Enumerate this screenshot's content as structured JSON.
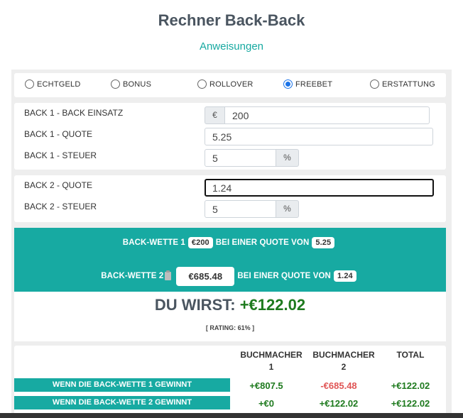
{
  "header": {
    "title": "Rechner Back-Back",
    "instructions_link": "Anweisungen"
  },
  "mode_options": [
    {
      "label": "ECHTGELD",
      "selected": false
    },
    {
      "label": "BONUS",
      "selected": false
    },
    {
      "label": "ROLLOVER",
      "selected": false
    },
    {
      "label": "FREEBET",
      "selected": true
    },
    {
      "label": "ERSTATTUNG",
      "selected": false
    }
  ],
  "back1": {
    "stake_label": "BACK 1 - BACK EINSATZ",
    "currency_symbol": "€",
    "stake_value": "200",
    "odds_label": "BACK 1 - QUOTE",
    "odds_value": "5.25",
    "tax_label": "BACK 1 - STEUER",
    "tax_value": "5",
    "tax_unit": "%"
  },
  "back2": {
    "odds_label": "BACK 2 - QUOTE",
    "odds_value": "1.24",
    "tax_label": "BACK 2 - STEUER",
    "tax_value": "5",
    "tax_unit": "%"
  },
  "summary": {
    "bet1_prefix": "BACK-WETTE 1",
    "bet1_stake": "€200",
    "bet1_mid": "BEI EINER QUOTE VON",
    "bet1_odds": "5.25",
    "bet2_prefix": "BACK-WETTE 2",
    "bet2_stake": "€685.48",
    "bet2_mid": "BEI EINER QUOTE VON",
    "bet2_odds": "1.24"
  },
  "result": {
    "label": "DU WIRST:",
    "value": "+€122.02",
    "rating": "[ RATING: 61% ]"
  },
  "table": {
    "headers": [
      "BUCHMACHER 1",
      "BUCHMACHER 2",
      "TOTAL"
    ],
    "rows": [
      {
        "label": "WENN DIE BACK-WETTE 1 GEWINNT",
        "bm1": "+€807.5",
        "bm2": "-€685.48",
        "total": "+€122.02"
      },
      {
        "label": "WENN DIE BACK-WETTE 2 GEWINNT",
        "bm1": "+€0",
        "bm2": "+€122.02",
        "total": "+€122.02"
      }
    ]
  },
  "colors": {
    "teal": "#17aaa2",
    "positive": "#1e7a1e",
    "negative": "#e05555",
    "radio_selected": "#1a73e8"
  }
}
